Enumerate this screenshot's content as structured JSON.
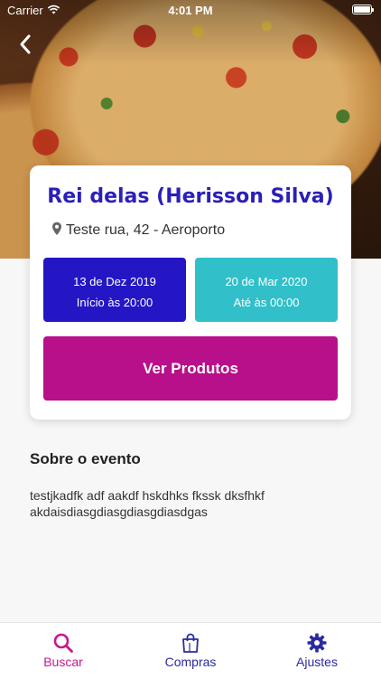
{
  "status_bar": {
    "carrier": "Carrier",
    "time": "4:01 PM"
  },
  "event": {
    "title": "Rei delas (Herisson Silva)",
    "address": "Teste rua, 42 - Aeroporto",
    "start": {
      "date": "13 de Dez 2019",
      "time_label": "Início às 20:00",
      "color": "#2416c4"
    },
    "end": {
      "date": "20 de Mar 2020",
      "time_label": "Até às 00:00",
      "color": "#31bfc9"
    },
    "cta_label": "Ver Produtos",
    "cta_color": "#b80f8a"
  },
  "about": {
    "heading": "Sobre o evento",
    "text": "testjkadfk adf aakdf hskdhks fkssk dksfhkf akdaisdiasgdiasgdiasgdiasdgas"
  },
  "tabbar": {
    "items": [
      {
        "label": "Buscar",
        "icon": "search-icon",
        "active": true
      },
      {
        "label": "Compras",
        "icon": "shopping-bag-icon",
        "active": false
      },
      {
        "label": "Ajustes",
        "icon": "gear-icon",
        "active": false
      }
    ],
    "active_color": "#c8178e",
    "inactive_color": "#2b2aa0"
  }
}
